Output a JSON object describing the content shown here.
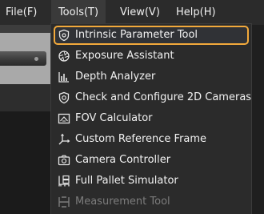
{
  "menubar": {
    "file": "File(F)",
    "tools": "Tools(T)",
    "view": "View(V)",
    "help": "Help(H)"
  },
  "tools_menu": {
    "items": [
      {
        "label": "Intrinsic Parameter Tool",
        "icon": "shield-icon",
        "state": "highlighted"
      },
      {
        "label": "Exposure Assistant",
        "icon": "aperture-icon",
        "state": "normal"
      },
      {
        "label": "Depth Analyzer",
        "icon": "bar-chart-icon",
        "state": "normal"
      },
      {
        "label": "Check and Configure 2D Cameras",
        "icon": "camera-shield-icon",
        "state": "normal"
      },
      {
        "label": "FOV Calculator",
        "icon": "fov-icon",
        "state": "normal"
      },
      {
        "label": "Custom Reference Frame",
        "icon": "axes-icon",
        "state": "normal"
      },
      {
        "label": "Camera Controller",
        "icon": "camera-icon",
        "state": "normal"
      },
      {
        "label": "Full Pallet Simulator",
        "icon": "pallet-icon",
        "state": "normal"
      },
      {
        "label": "Measurement Tool",
        "icon": "ruler-icon",
        "state": "disabled"
      }
    ]
  },
  "colors": {
    "highlight_border": "#f2a93b",
    "menu_background": "#2b2b2b",
    "text": "#f2f2f2",
    "disabled_text": "#7c7c7c"
  }
}
